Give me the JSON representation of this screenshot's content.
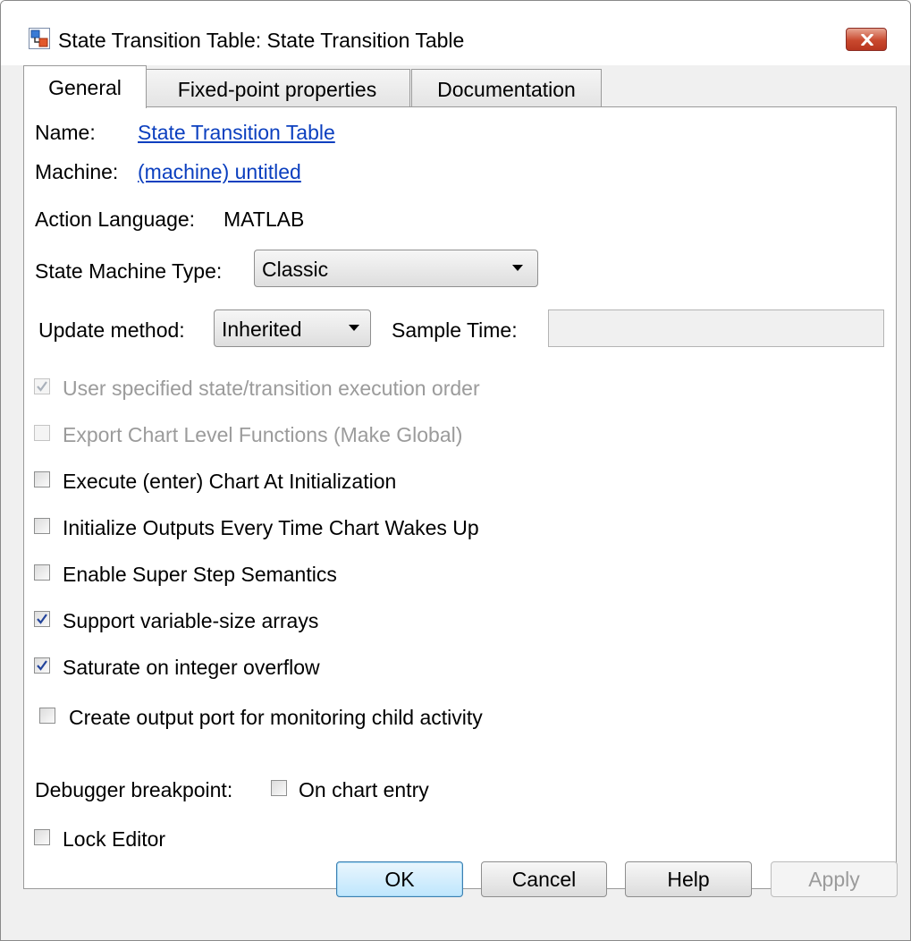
{
  "window": {
    "title": "State Transition Table: State Transition Table"
  },
  "tabs": [
    {
      "label": "General",
      "active": true
    },
    {
      "label": "Fixed-point properties",
      "active": false
    },
    {
      "label": "Documentation",
      "active": false
    }
  ],
  "general": {
    "name_label": "Name:",
    "name_value": "State Transition Table",
    "machine_label": "Machine:",
    "machine_value": "(machine) untitled",
    "action_language_label": "Action Language:",
    "action_language_value": "MATLAB",
    "state_machine_type_label": "State Machine Type:",
    "state_machine_type_value": "Classic",
    "update_method_label": "Update method:",
    "update_method_value": "Inherited",
    "sample_time_label": "Sample Time:",
    "sample_time_value": "",
    "checkboxes": [
      {
        "label": "User specified state/transition execution order",
        "checked": true,
        "enabled": false
      },
      {
        "label": "Export Chart Level Functions (Make Global)",
        "checked": false,
        "enabled": false
      },
      {
        "label": "Execute (enter) Chart At Initialization",
        "checked": false,
        "enabled": true
      },
      {
        "label": "Initialize Outputs Every Time Chart Wakes Up",
        "checked": false,
        "enabled": true
      },
      {
        "label": "Enable Super Step Semantics",
        "checked": false,
        "enabled": true
      },
      {
        "label": "Support variable-size arrays",
        "checked": true,
        "enabled": true
      },
      {
        "label": "Saturate on integer overflow",
        "checked": true,
        "enabled": true
      },
      {
        "label": "Create output port for monitoring child activity",
        "checked": false,
        "enabled": true
      }
    ],
    "debugger_label": "Debugger breakpoint:",
    "debugger_checkbox_label": "On chart entry",
    "lock_editor_label": "Lock Editor"
  },
  "buttons": {
    "ok": "OK",
    "cancel": "Cancel",
    "help": "Help",
    "apply": "Apply"
  },
  "colors": {
    "link": "#0b3fbf",
    "disabled_text": "#9b9b9b",
    "close_button": "#c9492e"
  }
}
